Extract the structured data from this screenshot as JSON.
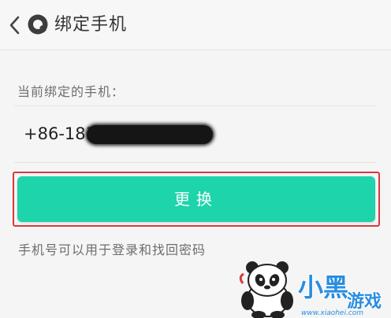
{
  "header": {
    "title": "绑定手机",
    "back_icon": "chevron-left-icon",
    "logo_icon": "app-logo-icon"
  },
  "binding": {
    "label": "当前绑定的手机：",
    "phone_visible": "+86-183",
    "phone_masked": true
  },
  "actions": {
    "change_label": "更换",
    "button_color": "#1dd4ab",
    "highlight_color": "#d9383b"
  },
  "hint": {
    "text": "手机号可以用于登录和找回密码"
  },
  "watermark": {
    "text": "小黑游戏",
    "domain": "www.xiaohei.com"
  }
}
